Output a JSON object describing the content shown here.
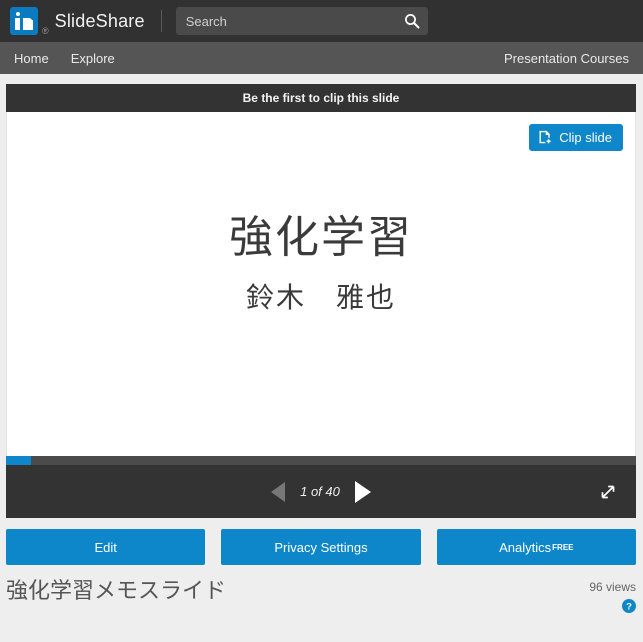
{
  "header": {
    "brand": "SlideShare",
    "registered_mark": "®",
    "logo_text": "in",
    "logo_color": "#0b7bc1",
    "search": {
      "placeholder": "Search",
      "value": "",
      "icon": "search-icon"
    }
  },
  "nav": {
    "left_items": [
      {
        "label": "Home"
      },
      {
        "label": "Explore"
      }
    ],
    "right_items": [
      {
        "label": "Presentation Courses"
      }
    ]
  },
  "player": {
    "clip_banner": "Be the first to clip this slide",
    "clip_button": {
      "label": "Clip slide",
      "icon": "clip-slide-icon",
      "color": "#0d87c9"
    },
    "slide": {
      "title": "強化学習",
      "author": "鈴木　雅也"
    },
    "current_page": 1,
    "total_pages": 40,
    "page_indicator": "1 of 40",
    "progress_percent": 4,
    "progress_color": "#0d87c9",
    "prev_icon": "previous-slide-icon",
    "next_icon": "next-slide-icon",
    "fullscreen_icon": "fullscreen-icon"
  },
  "actions": [
    {
      "label": "Edit",
      "name": "edit-button",
      "superscript": ""
    },
    {
      "label": "Privacy Settings",
      "name": "privacy-settings-button",
      "superscript": ""
    },
    {
      "label": "Analytics",
      "name": "analytics-button",
      "superscript": "FREE"
    }
  ],
  "footer": {
    "document_title": "強化学習メモスライド",
    "views": "96 views",
    "help_icon": "help-icon"
  }
}
